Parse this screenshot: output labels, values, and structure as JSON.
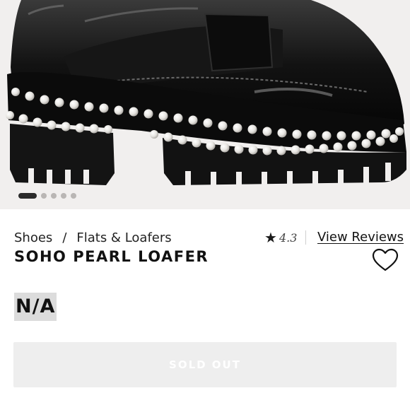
{
  "gallery": {
    "slide_count": 5,
    "active_slide": 1
  },
  "breadcrumb": {
    "items": [
      "Shoes",
      "Flats & Loafers"
    ],
    "separator": "/"
  },
  "rating": {
    "value": "4.3",
    "star": "★",
    "max": 5
  },
  "reviews_link": "View Reviews",
  "product": {
    "title": "SOHO PEARL LOAFER",
    "price": "N/A"
  },
  "wishlist": {
    "icon": "heart-outline-icon"
  },
  "buy_button": {
    "label": "SOLD OUT",
    "enabled": false
  },
  "colors": {
    "hero_background": "#f1efee",
    "price_highlight": "#dcdcdc",
    "button_background": "#eeeeee"
  }
}
